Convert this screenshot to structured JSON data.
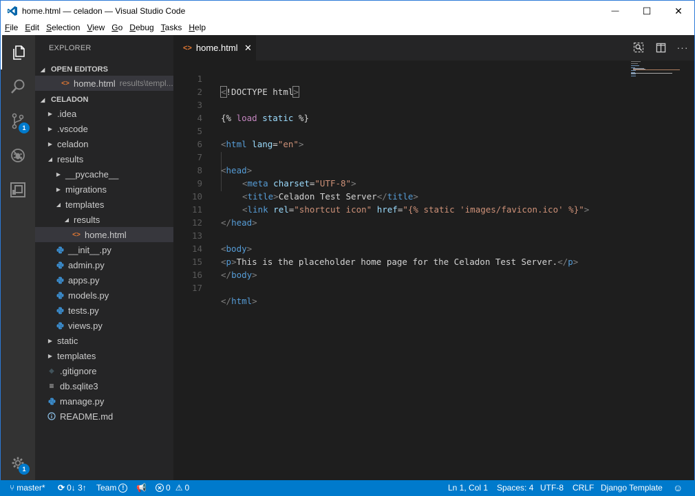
{
  "window": {
    "title": "home.html — celadon — Visual Studio Code",
    "controls": {
      "minimize": "—",
      "maximize": "☐",
      "close": "✕"
    }
  },
  "menu": [
    {
      "u": "F",
      "rest": "ile"
    },
    {
      "u": "E",
      "rest": "dit"
    },
    {
      "u": "S",
      "rest": "election"
    },
    {
      "u": "V",
      "rest": "iew"
    },
    {
      "u": "G",
      "rest": "o"
    },
    {
      "u": "D",
      "rest": "ebug"
    },
    {
      "u": "T",
      "rest": "asks"
    },
    {
      "u": "H",
      "rest": "elp"
    }
  ],
  "activity": {
    "scm_badge": "1",
    "settings_badge": "1"
  },
  "sidebar": {
    "title": "EXPLORER",
    "open_editors": {
      "header": "OPEN EDITORS",
      "item_label": "home.html",
      "item_desc": "results\\templ..."
    },
    "project": {
      "header": "CELADON",
      "items": [
        {
          "label": ".idea"
        },
        {
          "label": ".vscode"
        },
        {
          "label": "celadon"
        },
        {
          "label": "results"
        },
        {
          "label": "__pycache__"
        },
        {
          "label": "migrations"
        },
        {
          "label": "templates"
        },
        {
          "label": "results"
        },
        {
          "label": "home.html"
        },
        {
          "label": "__init__.py"
        },
        {
          "label": "admin.py"
        },
        {
          "label": "apps.py"
        },
        {
          "label": "models.py"
        },
        {
          "label": "tests.py"
        },
        {
          "label": "views.py"
        },
        {
          "label": "static"
        },
        {
          "label": "templates"
        },
        {
          "label": ".gitignore"
        },
        {
          "label": "db.sqlite3"
        },
        {
          "label": "manage.py"
        },
        {
          "label": "README.md"
        }
      ]
    }
  },
  "editor": {
    "tab_label": "home.html",
    "tab_close": "✕",
    "line_numbers": [
      "1",
      "2",
      "3",
      "4",
      "5",
      "6",
      "7",
      "8",
      "9",
      "10",
      "11",
      "12",
      "13",
      "14",
      "15",
      "16",
      "17"
    ],
    "code": {
      "l1_open": "<",
      "l1_doctype": "!DOCTYPE html",
      "l1_close": ">",
      "l3_open": "{%",
      "l3_load": "load",
      "l3_static": "static",
      "l3_close": "%}",
      "l5_lt": "<",
      "l5_tag": "html",
      "l5_attr": "lang",
      "l5_eq": "=",
      "l5_val": "\"en\"",
      "l5_gt": ">",
      "l7_lt": "<",
      "l7_tag": "head",
      "l7_gt": ">",
      "l8_lt": "<",
      "l8_tag": "meta",
      "l8_attr": "charset",
      "l8_eq": "=",
      "l8_val": "\"UTF-8\"",
      "l8_gt": ">",
      "l9_lt": "<",
      "l9_tag": "title",
      "l9_gt": ">",
      "l9_text": "Celadon Test Server",
      "l9_lt2": "</",
      "l9_tag2": "title",
      "l9_gt2": ">",
      "l10_lt": "<",
      "l10_tag": "link",
      "l10_attr1": "rel",
      "l10_eq1": "=",
      "l10_val1": "\"shortcut icon\"",
      "l10_attr2": "href",
      "l10_eq2": "=",
      "l10_val2": "\"{% static 'images/favicon.ico' %}\"",
      "l10_gt": ">",
      "l11_lt": "</",
      "l11_tag": "head",
      "l11_gt": ">",
      "l13_lt": "<",
      "l13_tag": "body",
      "l13_gt": ">",
      "l14_lt": "<",
      "l14_tag": "p",
      "l14_gt": ">",
      "l14_text": "This is the placeholder home page for the Celadon Test Server.",
      "l14_lt2": "</",
      "l14_tag2": "p",
      "l14_gt2": ">",
      "l15_lt": "</",
      "l15_tag": "body",
      "l15_gt": ">",
      "l17_lt": "</",
      "l17_tag": "html",
      "l17_gt": ">"
    }
  },
  "statusbar": {
    "branch": "master*",
    "sync": "0↓ 3↑",
    "team": "Team",
    "errors": "0",
    "warnings": "0",
    "position": "Ln 1, Col 1",
    "spaces": "Spaces: 4",
    "encoding": "UTF-8",
    "eol": "CRLF",
    "language": "Django Template"
  },
  "colors": {
    "accent": "#007acc",
    "activitybar": "#333333",
    "sidebar": "#252526",
    "editor": "#1e1e1e",
    "html_icon": "#e37933",
    "python_icon": "#3b8ed0"
  }
}
